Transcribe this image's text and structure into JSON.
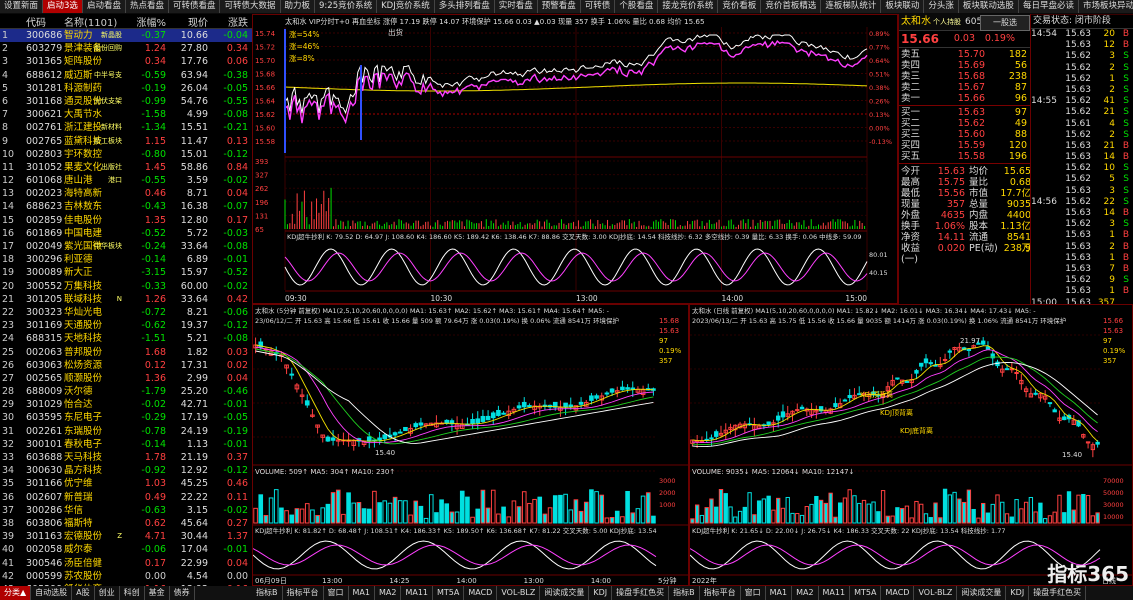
{
  "tabs": [
    "设置新面",
    "启动3选",
    "启动看盘",
    "热点看盘",
    "可转债看盘",
    "可转债大数据",
    "助力板",
    "9:25竞价系统",
    "KDJ竞价系统",
    "多头排列看盘",
    "实时看盘",
    "预警看盘",
    "可转债",
    "个股看盘",
    "接龙竞价系统",
    "竞价看板",
    "竞价首板精选",
    "连板梯队统计",
    "板块联动",
    "分头涨",
    "板块联动选股",
    "每日早盘必读",
    "市场板块异动"
  ],
  "active_tab": 1,
  "list_header": {
    "no": "",
    "code": "代码",
    "name": "名称(1101)",
    "pct": "涨幅%",
    "price": "现价",
    "chg": "涨跌"
  },
  "stocks": [
    {
      "no": "1",
      "code": "300686",
      "name": "智动力",
      "tag": "新晶股",
      "pct": "-0.37",
      "price": "10.66",
      "chg": "-0.04"
    },
    {
      "no": "2",
      "code": "603279",
      "name": "景津装备",
      "tag": "股份回购",
      "pct": "1.24",
      "price": "27.80",
      "chg": "0.34"
    },
    {
      "no": "3",
      "code": "301365",
      "name": "矩阵股份",
      "tag": "",
      "pct": "0.34",
      "price": "17.76",
      "chg": "0.06"
    },
    {
      "no": "4",
      "code": "688612",
      "name": "威迈斯",
      "tag": "中半号支",
      "pct": "-0.59",
      "price": "63.94",
      "chg": "-0.38"
    },
    {
      "no": "5",
      "code": "301281",
      "name": "科源制药",
      "tag": "",
      "pct": "-0.19",
      "price": "26.04",
      "chg": "-0.05"
    },
    {
      "no": "6",
      "code": "301168",
      "name": "通灵股份",
      "tag": "光伏支架",
      "pct": "-0.99",
      "price": "54.76",
      "chg": "-0.55"
    },
    {
      "no": "7",
      "code": "300621",
      "name": "大禹节水",
      "tag": "",
      "pct": "-1.58",
      "price": "4.99",
      "chg": "-0.08"
    },
    {
      "no": "8",
      "code": "002761",
      "name": "浙江建投",
      "tag": "新材料",
      "pct": "-1.34",
      "price": "15.51",
      "chg": "-0.21"
    },
    {
      "no": "9",
      "code": "002765",
      "name": "蓝黛科技",
      "tag": "新工板块",
      "pct": "1.15",
      "price": "11.47",
      "chg": "0.13"
    },
    {
      "no": "10",
      "code": "002803",
      "name": "宇环数控",
      "tag": "",
      "pct": "-0.80",
      "price": "15.01",
      "chg": "-0.12"
    },
    {
      "no": "11",
      "code": "301052",
      "name": "果麦文化",
      "tag": "出版社",
      "pct": "1.45",
      "price": "58.86",
      "chg": "0.84"
    },
    {
      "no": "12",
      "code": "601068",
      "name": "唐山港",
      "tag": "港口",
      "pct": "-0.55",
      "price": "3.59",
      "chg": "-0.02"
    },
    {
      "no": "13",
      "code": "002023",
      "name": "海特高新",
      "tag": "",
      "pct": "0.46",
      "price": "8.71",
      "chg": "0.04"
    },
    {
      "no": "14",
      "code": "688623",
      "name": "吉林敖东",
      "tag": "",
      "pct": "-0.43",
      "price": "16.38",
      "chg": "-0.07"
    },
    {
      "no": "15",
      "code": "002859",
      "name": "佳电股份",
      "tag": "",
      "pct": "1.35",
      "price": "12.80",
      "chg": "0.17"
    },
    {
      "no": "16",
      "code": "601869",
      "name": "中国电建",
      "tag": "",
      "pct": "-0.52",
      "price": "5.72",
      "chg": "-0.03"
    },
    {
      "no": "17",
      "code": "002049",
      "name": "紫光国微",
      "tag": "中华板块",
      "pct": "-0.24",
      "price": "33.64",
      "chg": "-0.08"
    },
    {
      "no": "18",
      "code": "300296",
      "name": "利亚德",
      "tag": "",
      "pct": "-0.14",
      "price": "6.89",
      "chg": "-0.01"
    },
    {
      "no": "19",
      "code": "300089",
      "name": "新大正",
      "tag": "",
      "pct": "-3.15",
      "price": "15.97",
      "chg": "-0.52"
    },
    {
      "no": "20",
      "code": "300552",
      "name": "万集科技",
      "tag": "",
      "pct": "-0.33",
      "price": "60.00",
      "chg": "-0.02"
    },
    {
      "no": "21",
      "code": "301205",
      "name": "联域科技",
      "tag": "N",
      "pct": "1.26",
      "price": "33.64",
      "chg": "0.42"
    },
    {
      "no": "22",
      "code": "300323",
      "name": "华灿光电",
      "tag": "",
      "pct": "-0.72",
      "price": "8.21",
      "chg": "-0.06"
    },
    {
      "no": "23",
      "code": "301169",
      "name": "天通股份",
      "tag": "",
      "pct": "-0.62",
      "price": "19.37",
      "chg": "-0.12"
    },
    {
      "no": "24",
      "code": "688315",
      "name": "天地科技",
      "tag": "",
      "pct": "-1.51",
      "price": "5.21",
      "chg": "-0.08"
    },
    {
      "no": "25",
      "code": "002063",
      "name": "普邦股份",
      "tag": "",
      "pct": "1.68",
      "price": "1.82",
      "chg": "0.03"
    },
    {
      "no": "26",
      "code": "603063",
      "name": "松炀资源",
      "tag": "",
      "pct": "0.12",
      "price": "17.31",
      "chg": "0.02"
    },
    {
      "no": "27",
      "code": "002565",
      "name": "顺灏股份",
      "tag": "",
      "pct": "1.36",
      "price": "2.99",
      "chg": "0.04"
    },
    {
      "no": "28",
      "code": "688009",
      "name": "沃尔德",
      "tag": "",
      "pct": "-1.79",
      "price": "25.20",
      "chg": "-0.46"
    },
    {
      "no": "29",
      "code": "301029",
      "name": "怡合达",
      "tag": "",
      "pct": "-0.02",
      "price": "42.71",
      "chg": "-0.01"
    },
    {
      "no": "30",
      "code": "603595",
      "name": "东尼电子",
      "tag": "",
      "pct": "-0.29",
      "price": "17.19",
      "chg": "-0.05"
    },
    {
      "no": "31",
      "code": "002261",
      "name": "东瑞股份",
      "tag": "",
      "pct": "-0.78",
      "price": "24.19",
      "chg": "-0.19"
    },
    {
      "no": "32",
      "code": "300101",
      "name": "春秋电子",
      "tag": "",
      "pct": "-0.14",
      "price": "1.13",
      "chg": "-0.01"
    },
    {
      "no": "33",
      "code": "603688",
      "name": "天马科技",
      "tag": "",
      "pct": "1.78",
      "price": "21.19",
      "chg": "0.37"
    },
    {
      "no": "34",
      "code": "300630",
      "name": "晶方科技",
      "tag": "",
      "pct": "-0.92",
      "price": "12.92",
      "chg": "-0.12"
    },
    {
      "no": "35",
      "code": "301166",
      "name": "优宁维",
      "tag": "",
      "pct": "1.03",
      "price": "45.25",
      "chg": "0.46"
    },
    {
      "no": "36",
      "code": "002607",
      "name": "新普瑞",
      "tag": "",
      "pct": "0.49",
      "price": "22.22",
      "chg": "0.11"
    },
    {
      "no": "37",
      "code": "300286",
      "name": "华信",
      "tag": "",
      "pct": "-0.63",
      "price": "3.15",
      "chg": "-0.02"
    },
    {
      "no": "38",
      "code": "603806",
      "name": "福斯特",
      "tag": "",
      "pct": "0.62",
      "price": "45.64",
      "chg": "0.27"
    },
    {
      "no": "39",
      "code": "301163",
      "name": "宏德股份",
      "tag": "Z",
      "pct": "4.71",
      "price": "30.44",
      "chg": "1.37"
    },
    {
      "no": "40",
      "code": "002058",
      "name": "威尔泰",
      "tag": "",
      "pct": "-0.06",
      "price": "17.04",
      "chg": "-0.01"
    },
    {
      "no": "41",
      "code": "300546",
      "name": "汤臣倍健",
      "tag": "",
      "pct": "0.17",
      "price": "22.99",
      "chg": "0.04"
    },
    {
      "no": "42",
      "code": "000599",
      "name": "苏农股份",
      "tag": "",
      "pct": "0.00",
      "price": "4.54",
      "chg": "0.00"
    },
    {
      "no": "43",
      "code": "605299",
      "name": "舒华体育",
      "tag": "",
      "pct": "1.16",
      "price": "13.92",
      "chg": "0.16"
    }
  ],
  "left_bottom_tabs": [
    "分类▲",
    "自动选股",
    "A股",
    "创业",
    "科创",
    "基金",
    "债券"
  ],
  "intraday": {
    "title_left": "太和水  VIP分时T+0  再血坐标  涨停 17.19  跌停 14.07  环境保护  15.66  0.03  ▲0.03  现量 357  换手 1.06%  量比 0.68  均价 15.65",
    "price_axis": [
      "15.74",
      "15.72",
      "15.70",
      "15.68",
      "15.66",
      "15.64",
      "15.62",
      "15.60",
      "15.58"
    ],
    "pct_axis": [
      "0.89%",
      "0.77%",
      "0.64%",
      "0.51%",
      "0.38%",
      "0.26%",
      "0.13%",
      "0.00%",
      "-0.13%"
    ],
    "annotations": [
      "涨=54%",
      "涨=46%",
      "涨=8%",
      "出货"
    ],
    "vol_axis": [
      "393",
      "327",
      "262",
      "196",
      "131",
      "65"
    ],
    "kdj_label": "KDJ超牛抄利  K: 79.52  D: 64.97  J: 108.60  K4: 186.60  K5: 189.42  K6: 138.46  K7: 88.86  交叉天数: 3.00  KDJ抄底: 14.54  科技线抄: 6.32  多空线抄: 0.39  量比: 6.33  换手: 0.06  中线多: 59.09",
    "kdj_axis": [
      "80.01",
      "40.15"
    ],
    "time_axis": [
      "09:30",
      "10:30",
      "13:00",
      "14:00",
      "15:00"
    ],
    "right_axis_top": [
      "15.66",
      "15.63",
      "97",
      "0.03%",
      "357"
    ]
  },
  "quote": {
    "name": "太和水",
    "subtag": "个人持股",
    "code": "605081",
    "btn": "一股选",
    "price": "15.66",
    "chg": "0.03",
    "pct": "0.19%",
    "asks": [
      {
        "label": "卖五",
        "price": "15.70",
        "vol": "182"
      },
      {
        "label": "卖四",
        "price": "15.69",
        "vol": "56"
      },
      {
        "label": "卖三",
        "price": "15.68",
        "vol": "238"
      },
      {
        "label": "卖二",
        "price": "15.67",
        "vol": "87"
      },
      {
        "label": "卖一",
        "price": "15.66",
        "vol": "96"
      }
    ],
    "bids": [
      {
        "label": "买一",
        "price": "15.63",
        "vol": "97"
      },
      {
        "label": "买二",
        "price": "15.62",
        "vol": "49"
      },
      {
        "label": "买三",
        "price": "15.60",
        "vol": "88"
      },
      {
        "label": "买四",
        "price": "15.59",
        "vol": "120"
      },
      {
        "label": "买五",
        "price": "15.58",
        "vol": "196"
      }
    ],
    "stats": [
      {
        "k1": "今开",
        "v1": "15.63",
        "k2": "均价",
        "v2": "15.65"
      },
      {
        "k1": "最高",
        "v1": "15.75",
        "k2": "量比",
        "v2": "0.68"
      },
      {
        "k1": "最低",
        "v1": "15.56",
        "k2": "市值",
        "v2": "17.7亿"
      },
      {
        "k1": "现量",
        "v1": "357",
        "k2": "总量",
        "v2": "9035"
      },
      {
        "k1": "外盘",
        "v1": "4635",
        "k2": "内盘",
        "v2": "4400"
      },
      {
        "k1": "换手",
        "v1": "1.06%",
        "k2": "股本",
        "v2": "1.13亿"
      },
      {
        "k1": "净资",
        "v1": "14.11",
        "k2": "流通",
        "v2": "8541万"
      },
      {
        "k1": "收益(一)",
        "v1": "0.020",
        "k2": "PE(动)",
        "v2": "238.9"
      }
    ]
  },
  "ticks": {
    "header": "交易状态: 闭市阶段",
    "rows": [
      {
        "t": "14:54",
        "p": "15.63",
        "v": "20",
        "s": "B"
      },
      {
        "t": "",
        "p": "15.63",
        "v": "12",
        "s": "B"
      },
      {
        "t": "",
        "p": "15.62",
        "v": "3",
        "s": "S"
      },
      {
        "t": "",
        "p": "15.62",
        "v": "2",
        "s": "S"
      },
      {
        "t": "",
        "p": "15.62",
        "v": "1",
        "s": "S"
      },
      {
        "t": "",
        "p": "15.63",
        "v": "2",
        "s": "S"
      },
      {
        "t": "14:55",
        "p": "15.62",
        "v": "41",
        "s": "S"
      },
      {
        "t": "",
        "p": "15.62",
        "v": "21",
        "s": "S"
      },
      {
        "t": "",
        "p": "15.61",
        "v": "4",
        "s": "S"
      },
      {
        "t": "",
        "p": "15.62",
        "v": "2",
        "s": "S"
      },
      {
        "t": "",
        "p": "15.63",
        "v": "21",
        "s": "B"
      },
      {
        "t": "",
        "p": "15.63",
        "v": "14",
        "s": "B"
      },
      {
        "t": "",
        "p": "15.62",
        "v": "10",
        "s": "S"
      },
      {
        "t": "",
        "p": "15.62",
        "v": "5",
        "s": "S"
      },
      {
        "t": "",
        "p": "15.63",
        "v": "3",
        "s": "S"
      },
      {
        "t": "14:56",
        "p": "15.62",
        "v": "22",
        "s": "S"
      },
      {
        "t": "",
        "p": "15.63",
        "v": "14",
        "s": "B"
      },
      {
        "t": "",
        "p": "15.62",
        "v": "3",
        "s": "S"
      },
      {
        "t": "",
        "p": "15.63",
        "v": "1",
        "s": "B"
      },
      {
        "t": "",
        "p": "15.63",
        "v": "2",
        "s": "B"
      },
      {
        "t": "",
        "p": "15.63",
        "v": "1",
        "s": "B"
      },
      {
        "t": "",
        "p": "15.63",
        "v": "7",
        "s": "B"
      },
      {
        "t": "",
        "p": "15.62",
        "v": "9",
        "s": "S"
      },
      {
        "t": "",
        "p": "15.63",
        "v": "1",
        "s": "B"
      },
      {
        "t": "15:00",
        "p": "15.63",
        "v": "357",
        "s": ""
      }
    ]
  },
  "chart5m": {
    "title": "太和水 (5分钟 前复权)  MA1(2,5,10,20,60,0,0,0,0)  MA1: 15.63↑  MA2: 15.62↑  MA3: 15.61↑  MA4: 15.64↑  MA5: -",
    "sub": "23/06/12/二  开 15.63  高 15.66  低 15.61  收 15.66  量 509  额 79.64万  涨 0.03(0.19%)  换 0.06%  流通 8541万  环境保护",
    "price_axis": [
      "15.68",
      "15.63",
      "97",
      "0.19%",
      "357"
    ],
    "low_label": "15.40",
    "vol_title": "VOLUME: 509↑  MA5: 304↑  MA10: 230↑",
    "vol_axis": [
      "3000",
      "2000",
      "1000"
    ],
    "kdj_title": "KDJ超牛抄利  K: 81.82↑  D: 68.48↑  J: 108.51↑  K4: 186.33↑  K5: 189.50↑  K6: 136.68↑  K7: 81.22  交叉天数: 5.00  KDJ抄底: 13.54",
    "time_axis": [
      "06月09日",
      "13:00",
      "14:25",
      "14:00",
      "13:00",
      "14:00",
      "5分钟"
    ]
  },
  "chartDay": {
    "title": "太和水 (日线 前复权)  MA1(5,10,20,60,0,0,0,0)  MA1: 15.82↓  MA2: 16.01↓  MA3: 16.34↓  MA4: 17.43↓  MA5: -",
    "sub": "2023/06/13/二  开 15.63  高 15.75  低 15.56  收 15.66  量 9035  额 1414万  涨 0.03(0.19%)  换 1.06%  流通 8541万  环境保护",
    "price_axis": [
      "15.66",
      "15.63",
      "97",
      "0.19%",
      "357"
    ],
    "high_label": "21.97",
    "low_label": "15.40",
    "annots": [
      "KDJ顶背离",
      "KDJ顶背离",
      "KDJ底背离"
    ],
    "vol_title": "VOLUME: 9035↓  MA5: 12064↓  MA10: 12147↓",
    "vol_axis": [
      "70000",
      "50000",
      "30000",
      "10000"
    ],
    "kdj_title": "KDJ超牛抄利  K: 21.65↓  D: 22.00↓  J: 26.75↓  K4: 186.33  交叉天数: 22  KDJ抄底: 13.54  科技线抄: 1.77",
    "time_axis": [
      "2022年",
      "",
      "",
      "",
      "",
      "",
      "日线"
    ]
  },
  "bottom_tabs": [
    "指标B",
    "指标平台",
    "窗口",
    "MA1",
    "MA2",
    "MA11",
    "MT5A",
    "MACD",
    "VOL-BLZ",
    "阅读成交量",
    "KDJ",
    "操盘手红色买",
    "指标B",
    "指标平台",
    "窗口",
    "MA1",
    "MA2",
    "MA11",
    "MT5A",
    "MACD",
    "VOL-BLZ",
    "阅读成交量",
    "KDJ",
    "操盘手红色买"
  ],
  "watermark": "指标365",
  "colors": {
    "up": "#ff4040",
    "down": "#00e000",
    "ma_yellow": "#f0e000",
    "ma_magenta": "#ff40ff",
    "ma_green": "#20d020",
    "border": "#6a0000"
  }
}
